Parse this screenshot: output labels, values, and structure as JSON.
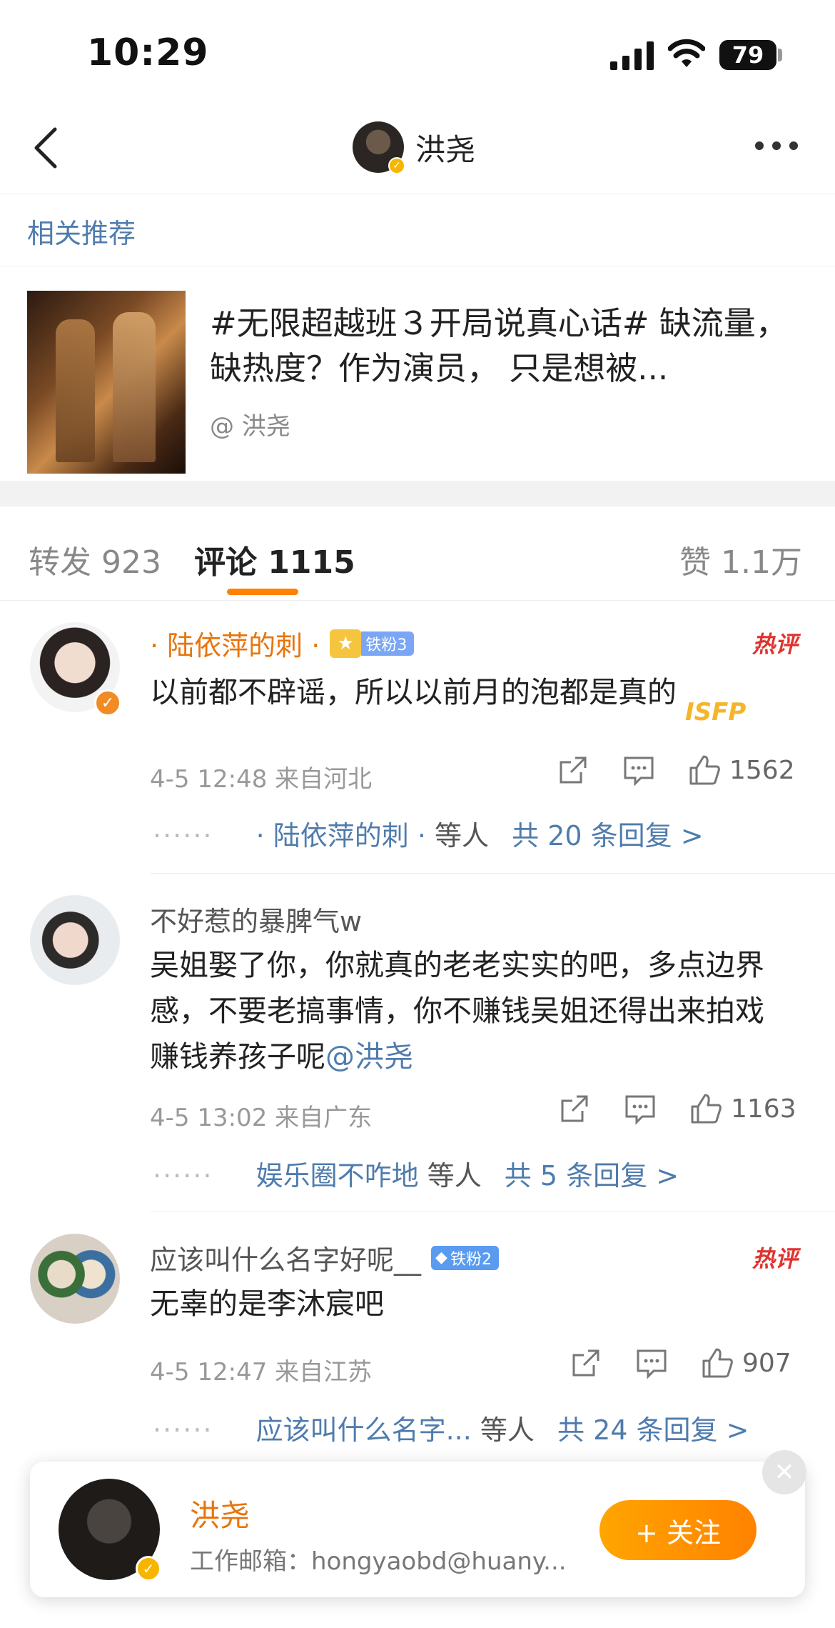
{
  "status_bar": {
    "time": "10:29",
    "battery": "79"
  },
  "nav": {
    "title": "洪尧"
  },
  "related": {
    "label": "相关推荐",
    "text": "#无限超越班３开局说真心话# 缺流量，缺热度？作为演员，  只是想被...",
    "author": "@ 洪尧"
  },
  "tabs": {
    "repost": "转发 923",
    "comment": "评论 1115",
    "like": "赞 1.1万"
  },
  "comments": [
    {
      "name": "· 陆依萍的刺 ·",
      "fan_label": "铁粉3",
      "hot": "热评",
      "deco": "ISFP",
      "text": "以前都不辟谣，所以以前月的泡都是真的",
      "meta": "4-5 12:48  来自河北",
      "likes": "1562",
      "replies_who": "· 陆依萍的刺 ·",
      "replies_etc": "等人",
      "replies_count": "共 20 条回复 >"
    },
    {
      "name": "不好惹的暴脾气w",
      "text": "吴姐娶了你，你就真的老老实实的吧，多点边界感，不要老搞事情，你不赚钱吴姐还得出来拍戏赚钱养孩子呢",
      "mention": "@洪尧",
      "meta": "4-5 13:02  来自广东",
      "likes": "1163",
      "replies_who": "娱乐圈不咋地",
      "replies_etc": "等人",
      "replies_count": "共 5 条回复 >"
    },
    {
      "name": "应该叫什么名字好呢__",
      "fan_label": "铁粉2",
      "hot": "热评",
      "text": "无辜的是李沐宸吧",
      "meta": "4-5 12:47  来自江苏",
      "likes": "907",
      "replies_who": "应该叫什么名字...",
      "replies_etc": "等人",
      "replies_count": "共 24 条回复 >"
    }
  ],
  "float_card": {
    "name": "洪尧",
    "email": "工作邮箱：hongyaobd@huany...",
    "follow": "+ 关注"
  },
  "colors": {
    "accent": "#ff8200",
    "link": "#4f7cad",
    "hot": "#e0332e",
    "vip": "#e8740c"
  }
}
